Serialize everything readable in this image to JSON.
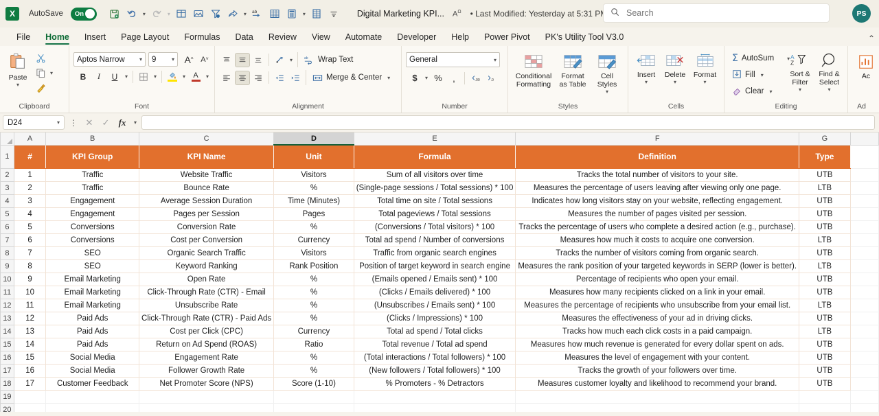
{
  "titlebar": {
    "app_icon": "excel-logo",
    "autosave_label": "AutoSave",
    "autosave_state": "On",
    "document_title": "Digital Marketing KPI...",
    "modified_meta": "• Last Modified: Yesterday at 5:31 PM",
    "search_placeholder": "Search",
    "avatar_initials": "PS",
    "quick_access": [
      {
        "name": "save-icon",
        "glyph": "↺"
      },
      {
        "name": "undo-icon",
        "glyph": "↶"
      },
      {
        "name": "redo-icon",
        "glyph": "↷"
      },
      {
        "name": "table-icon",
        "glyph": "⊞"
      },
      {
        "name": "picture-icon",
        "glyph": "ὛC"
      },
      {
        "name": "filter-icon",
        "glyph": "▽"
      },
      {
        "name": "share-icon",
        "glyph": "↗"
      },
      {
        "name": "spelling-icon",
        "glyph": "ab"
      },
      {
        "name": "pivot-table-icon",
        "glyph": "▦"
      },
      {
        "name": "calculator-icon",
        "glyph": "▤"
      },
      {
        "name": "sheet-icon",
        "glyph": "▥"
      },
      {
        "name": "customize-qat-icon",
        "glyph": "⌄"
      }
    ]
  },
  "menubar": {
    "items": [
      {
        "label": "File",
        "active": false
      },
      {
        "label": "Home",
        "active": true
      },
      {
        "label": "Insert",
        "active": false
      },
      {
        "label": "Page Layout",
        "active": false
      },
      {
        "label": "Formulas",
        "active": false
      },
      {
        "label": "Data",
        "active": false
      },
      {
        "label": "Review",
        "active": false
      },
      {
        "label": "View",
        "active": false
      },
      {
        "label": "Automate",
        "active": false
      },
      {
        "label": "Developer",
        "active": false
      },
      {
        "label": "Help",
        "active": false
      },
      {
        "label": "Power Pivot",
        "active": false
      },
      {
        "label": "PK's Utility Tool V3.0",
        "active": false
      }
    ]
  },
  "ribbon": {
    "clipboard": {
      "label": "Clipboard",
      "paste_label": "Paste",
      "cut_label": "cut-icon",
      "copy_label": "copy-icon",
      "format_painter_label": "format-painter-icon"
    },
    "font": {
      "label": "Font",
      "font_name": "Aptos Narrow",
      "font_size": "9",
      "grow_font": "A",
      "shrink_font": "A",
      "bold": "B",
      "italic": "I",
      "underline": "U",
      "borders": "⊞",
      "fill_color": "A",
      "font_color": "A"
    },
    "alignment": {
      "label": "Alignment",
      "wrap_text": "Wrap Text",
      "merge_center": "Merge & Center",
      "orientation": "orientation-icon",
      "decrease_indent": "decrease-indent-icon",
      "increase_indent": "increase-indent-icon"
    },
    "number": {
      "label": "Number",
      "format": "General",
      "currency": "$",
      "percent": "%",
      "comma": ",",
      "increase_decimal": ".00",
      "decrease_decimal": ".0"
    },
    "styles": {
      "label": "Styles",
      "conditional_formatting": "Conditional Formatting",
      "format_as_table": "Format as Table",
      "cell_styles": "Cell Styles"
    },
    "cells": {
      "label": "Cells",
      "insert": "Insert",
      "delete": "Delete",
      "format": "Format"
    },
    "editing": {
      "label": "Editing",
      "autosum": "AutoSum",
      "fill": "Fill",
      "clear": "Clear",
      "sort_filter": "Sort & Filter",
      "find_select": "Find & Select"
    },
    "analysis": {
      "label": "Ad",
      "button": "Ac"
    }
  },
  "formulabar": {
    "name_box": "D24",
    "cancel_icon": "✕",
    "enter_icon": "✓",
    "function_icon": "fx",
    "formula_value": ""
  },
  "grid": {
    "columns": [
      "A",
      "B",
      "C",
      "D",
      "E",
      "F",
      "G"
    ],
    "selected_column": "D",
    "selected_cell": "D24",
    "row_numbers": [
      "1",
      "2",
      "3",
      "4",
      "5",
      "6",
      "7",
      "8",
      "9",
      "10",
      "11",
      "12",
      "13",
      "14",
      "15",
      "16",
      "17",
      "18",
      "19",
      "20"
    ],
    "headers": [
      "#",
      "KPI Group",
      "KPI Name",
      "Unit",
      "Formula",
      "Definition",
      "Type"
    ],
    "header_bg": "#e2702d",
    "rows": [
      [
        "1",
        "Traffic",
        "Website Traffic",
        "Visitors",
        "Sum of all visitors over time",
        "Tracks the total number of visitors to your site.",
        "UTB"
      ],
      [
        "2",
        "Traffic",
        "Bounce Rate",
        "%",
        "(Single-page sessions / Total sessions) * 100",
        "Measures the percentage of users leaving after viewing only one page.",
        "LTB"
      ],
      [
        "3",
        "Engagement",
        "Average Session Duration",
        "Time (Minutes)",
        "Total time on site / Total sessions",
        "Indicates how long visitors stay on your website, reflecting engagement.",
        "UTB"
      ],
      [
        "4",
        "Engagement",
        "Pages per Session",
        "Pages",
        "Total pageviews / Total sessions",
        "Measures the number of pages visited per session.",
        "UTB"
      ],
      [
        "5",
        "Conversions",
        "Conversion Rate",
        "%",
        "(Conversions / Total visitors) * 100",
        "Tracks the percentage of users who complete a desired action (e.g., purchase).",
        "UTB"
      ],
      [
        "6",
        "Conversions",
        "Cost per Conversion",
        "Currency",
        "Total ad spend / Number of conversions",
        "Measures how much it costs to acquire one conversion.",
        "LTB"
      ],
      [
        "7",
        "SEO",
        "Organic Search Traffic",
        "Visitors",
        "Traffic from organic search engines",
        "Tracks the number of visitors coming from organic search.",
        "UTB"
      ],
      [
        "8",
        "SEO",
        "Keyword Ranking",
        "Rank Position",
        "Position of target keyword in search engine",
        "Measures the rank position of your targeted keywords in SERP (lower is better).",
        "LTB"
      ],
      [
        "9",
        "Email Marketing",
        "Open Rate",
        "%",
        "(Emails opened / Emails sent) * 100",
        "Percentage of recipients who open your email.",
        "UTB"
      ],
      [
        "10",
        "Email Marketing",
        "Click-Through Rate (CTR) - Email",
        "%",
        "(Clicks / Emails delivered) * 100",
        "Measures how many recipients clicked on a link in your email.",
        "UTB"
      ],
      [
        "11",
        "Email Marketing",
        "Unsubscribe Rate",
        "%",
        "(Unsubscribes / Emails sent) * 100",
        "Measures the percentage of recipients who unsubscribe from your email list.",
        "LTB"
      ],
      [
        "12",
        "Paid Ads",
        "Click-Through Rate (CTR) - Paid Ads",
        "%",
        "(Clicks / Impressions) * 100",
        "Measures the effectiveness of your ad in driving clicks.",
        "UTB"
      ],
      [
        "13",
        "Paid Ads",
        "Cost per Click (CPC)",
        "Currency",
        "Total ad spend / Total clicks",
        "Tracks how much each click costs in a paid campaign.",
        "LTB"
      ],
      [
        "14",
        "Paid Ads",
        "Return on Ad Spend (ROAS)",
        "Ratio",
        "Total revenue / Total ad spend",
        "Measures how much revenue is generated for every dollar spent on ads.",
        "UTB"
      ],
      [
        "15",
        "Social Media",
        "Engagement Rate",
        "%",
        "(Total interactions / Total followers) * 100",
        "Measures the level of engagement with your content.",
        "UTB"
      ],
      [
        "16",
        "Social Media",
        "Follower Growth Rate",
        "%",
        "(New followers / Total followers) * 100",
        "Tracks the growth of your followers over time.",
        "UTB"
      ],
      [
        "17",
        "Customer Feedback",
        "Net Promoter Score (NPS)",
        "Score (1-10)",
        "% Promoters - % Detractors",
        "Measures customer loyalty and likelihood to recommend your brand.",
        "UTB"
      ]
    ]
  }
}
